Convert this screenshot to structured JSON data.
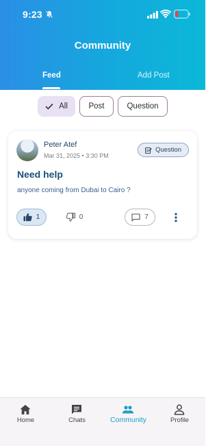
{
  "status_bar": {
    "time": "9:23",
    "icons": [
      "bell-off-icon",
      "signal-icon",
      "wifi-icon",
      "battery-low-icon"
    ],
    "battery_color": "#e5483c"
  },
  "header": {
    "title": "Community",
    "tabs": [
      {
        "label": "Feed",
        "active": true
      },
      {
        "label": "Add Post",
        "active": false
      }
    ],
    "gradient": [
      "#2a8fe6",
      "#0bb8d8"
    ]
  },
  "filters": [
    {
      "label": "All",
      "selected": true,
      "icon": "check-icon"
    },
    {
      "label": "Post",
      "selected": false
    },
    {
      "label": "Question",
      "selected": false
    }
  ],
  "posts": [
    {
      "author": "Peter Atef",
      "date": "Mar 31, 2025",
      "time": "3:30 PM",
      "type": "Question",
      "title": "Need help",
      "body": "anyone coming from Dubai to Cairo ?",
      "likes": "1",
      "dislikes": "0",
      "comments": "7"
    }
  ],
  "bottom_nav": [
    {
      "label": "Home",
      "icon": "home-icon",
      "active": false
    },
    {
      "label": "Chats",
      "icon": "chat-icon",
      "active": false
    },
    {
      "label": "Community",
      "icon": "community-icon",
      "active": true
    },
    {
      "label": "Profile",
      "icon": "profile-icon",
      "active": false
    }
  ],
  "colors": {
    "accent": "#1aa0c9",
    "text_primary": "#1d4f7c",
    "chip_selected_bg": "#e8e0f3"
  }
}
